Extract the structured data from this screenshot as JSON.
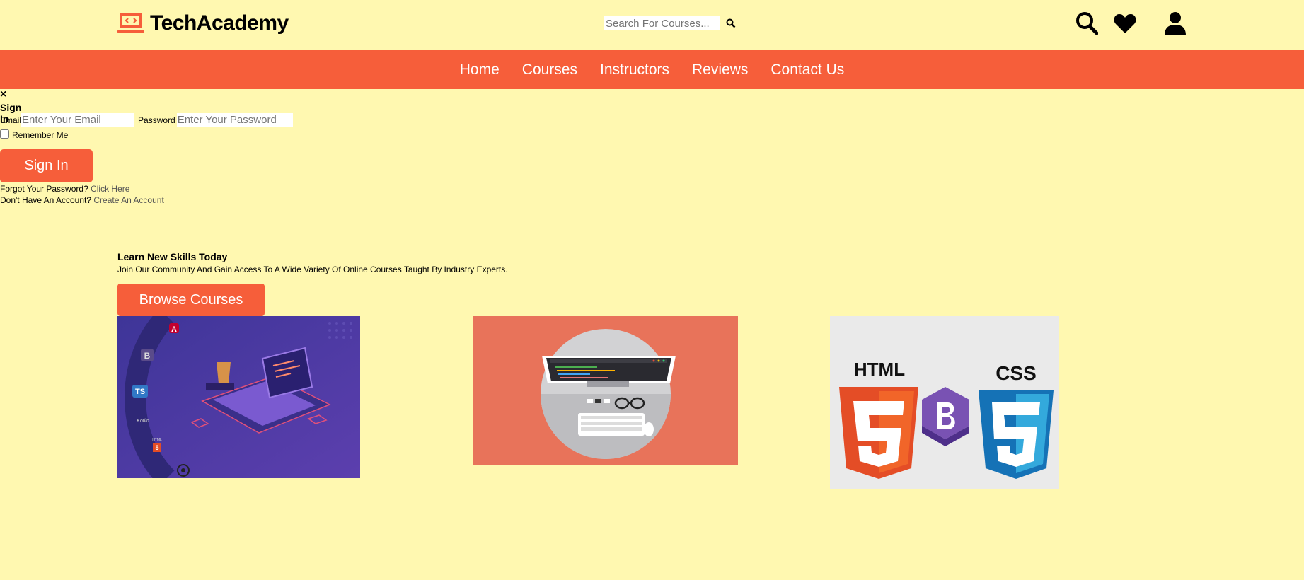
{
  "brand": {
    "name": "TechAcademy",
    "logo_icon": "laptop-code-icon",
    "color": "#f65e3a"
  },
  "search": {
    "placeholder": "Search For Courses...",
    "icon": "search-icon"
  },
  "header_icons": [
    "search-icon",
    "heart-icon",
    "user-icon"
  ],
  "nav": {
    "items": [
      "Home",
      "Courses",
      "Instructors",
      "Reviews",
      "Contact Us"
    ]
  },
  "login": {
    "close": "×",
    "title": "Sign In",
    "email_label": "Email",
    "email_placeholder": "Enter Your Email",
    "password_label": "Password",
    "password_placeholder": "Enter Your Password",
    "remember": "Remember Me",
    "submit": "Sign In",
    "forgot_text": "Forgot Your Password?",
    "forgot_link": "Click Here",
    "no_account_text": "Don't Have An Account?",
    "create_link": "Create An Account"
  },
  "hero": {
    "title": "Learn New Skills Today",
    "subtitle": "Join Our Community And Gain Access To A Wide Variety Of Online Courses Taught By Industry Experts.",
    "button": "Browse Courses"
  },
  "course_images": {
    "img1_badges": [
      "A",
      "B",
      "TS",
      "Kotlin",
      "HTML",
      "5"
    ],
    "img3_labels": [
      "HTML",
      "CSS"
    ]
  },
  "colors": {
    "background": "#fff8b0",
    "accent": "#f65e3a"
  }
}
